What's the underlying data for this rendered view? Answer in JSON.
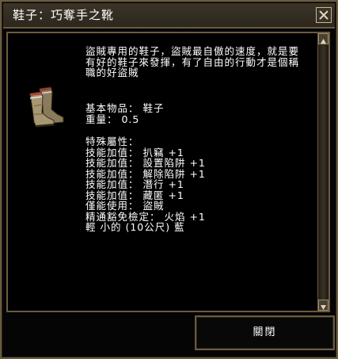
{
  "window": {
    "title": "鞋子：巧奪手之靴"
  },
  "item": {
    "icon": "boots-icon",
    "description": [
      "盜賊專用的鞋子，盜賊最自傲的速度，就是要",
      "有好的鞋子來發揮，有了自由的行動才是個稱",
      "職的好盜賊"
    ],
    "base_item": "基本物品： 鞋子",
    "weight": "重量： 0.5",
    "special_header": "特殊屬性：",
    "properties": [
      "技能加值： 扒竊 +1",
      "技能加值： 設置陷阱 +1",
      "技能加值： 解除陷阱 +1",
      "技能加值： 潛行 +1",
      "技能加值： 藏匿 +1",
      "僅能使用： 盜賊",
      "精通豁免檢定： 火焰 +1",
      "輕 小的 (10公尺)  藍"
    ]
  },
  "buttons": {
    "close_label": "關閉",
    "close_icon": "close-x-icon"
  },
  "colors": {
    "frame": "#6a5a40",
    "background": "#000000",
    "text": "#ffffff"
  }
}
